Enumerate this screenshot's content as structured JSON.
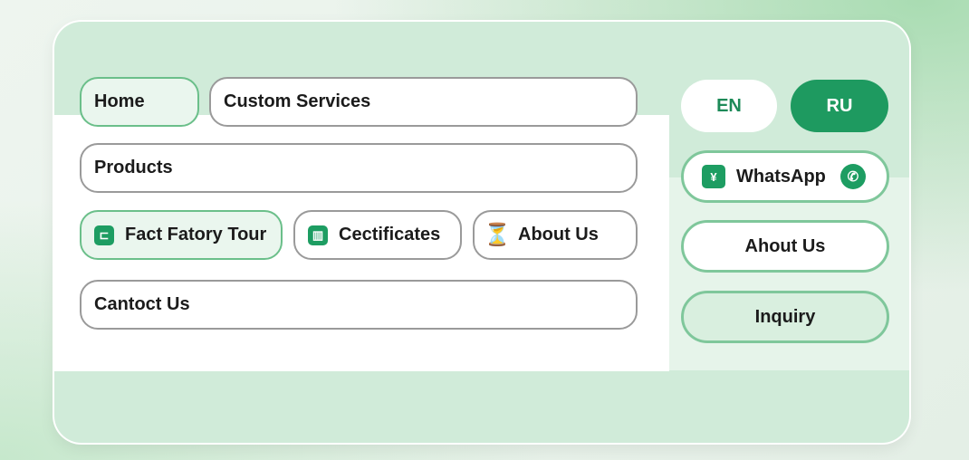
{
  "nav": {
    "home": "Home",
    "custom_services": "Custom Services",
    "products": "Products",
    "factory_tour": "Fact Fatory Tour",
    "certificates": "Cectificates",
    "about_us": "About Us",
    "contact_us": "Cantoct Us"
  },
  "side": {
    "lang_en": "EN",
    "lang_ru": "RU",
    "whatsapp": "WhatsApp",
    "about": "Ahout Us",
    "inquiry": "Inquiry"
  },
  "icons": {
    "factory_tour": "factory-tour-icon",
    "certificates": "certificate-icon",
    "about_us": "about-us-icon",
    "whatsapp_badge": "chevron-badge-icon",
    "whatsapp_logo": "whatsapp-icon"
  },
  "colors": {
    "accent": "#1e9a60",
    "active_border": "#6bbf8a",
    "card_bg": "#d0ebd9"
  }
}
